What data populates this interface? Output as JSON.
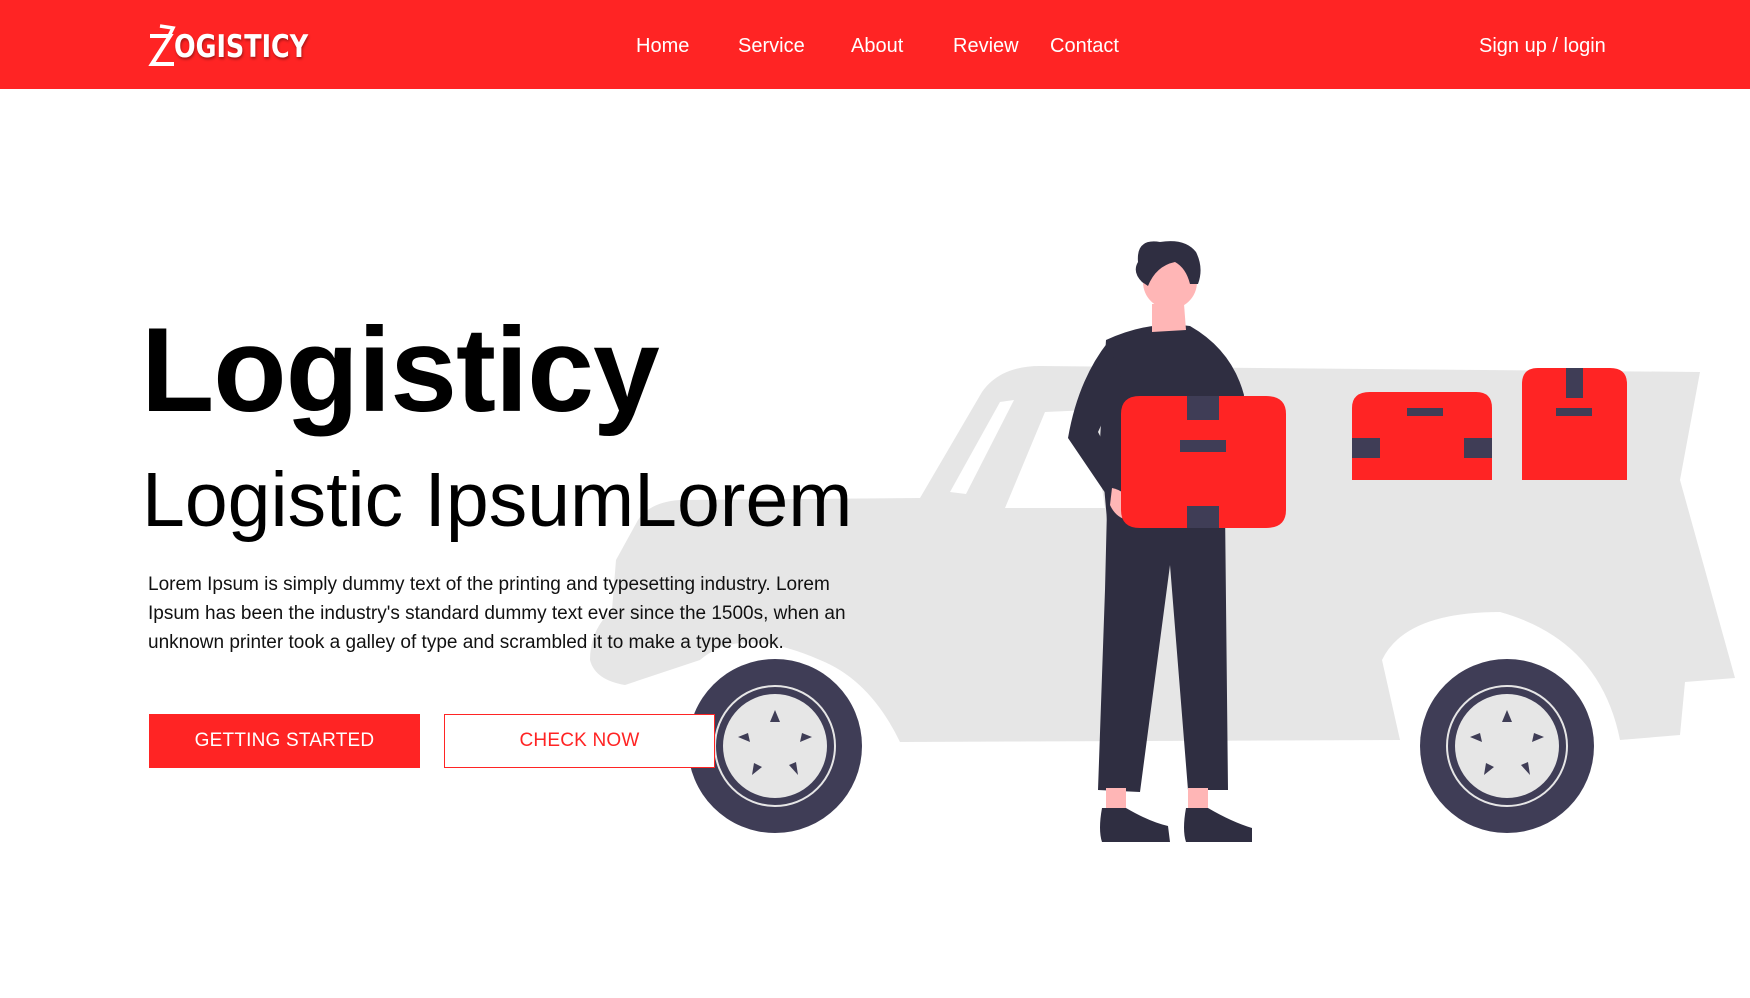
{
  "brand": {
    "logo_text": "OGISTICY",
    "logo_lettering": "ZOGISTICY",
    "primary_color": "#ff2424"
  },
  "nav": {
    "items": [
      {
        "label": "Home"
      },
      {
        "label": "Service"
      },
      {
        "label": "About"
      },
      {
        "label": "Review"
      },
      {
        "label": "Contact"
      }
    ],
    "auth_label": "Sign up / login"
  },
  "hero": {
    "title": "Logisticy",
    "subtitle": "Logistic IpsumLorem",
    "description": "Lorem Ipsum is simply dummy text of the printing and typesetting industry. Lorem Ipsum has been the industry's standard dummy text ever since the 1500s, when an unknown printer took a galley of type and scrambled it to make a type book.",
    "primary_button": "GETTING STARTED",
    "secondary_button": "CHECK NOW"
  },
  "illustration": {
    "icons": [
      "pickup-truck-illustration",
      "delivery-man-illustration",
      "package-box-illustration"
    ],
    "colors": {
      "truck": "#e6e6e6",
      "box": "#ff2424",
      "clothing": "#2f2e41",
      "skin": "#ffb6b6",
      "wheel": "#3f3d56"
    }
  }
}
